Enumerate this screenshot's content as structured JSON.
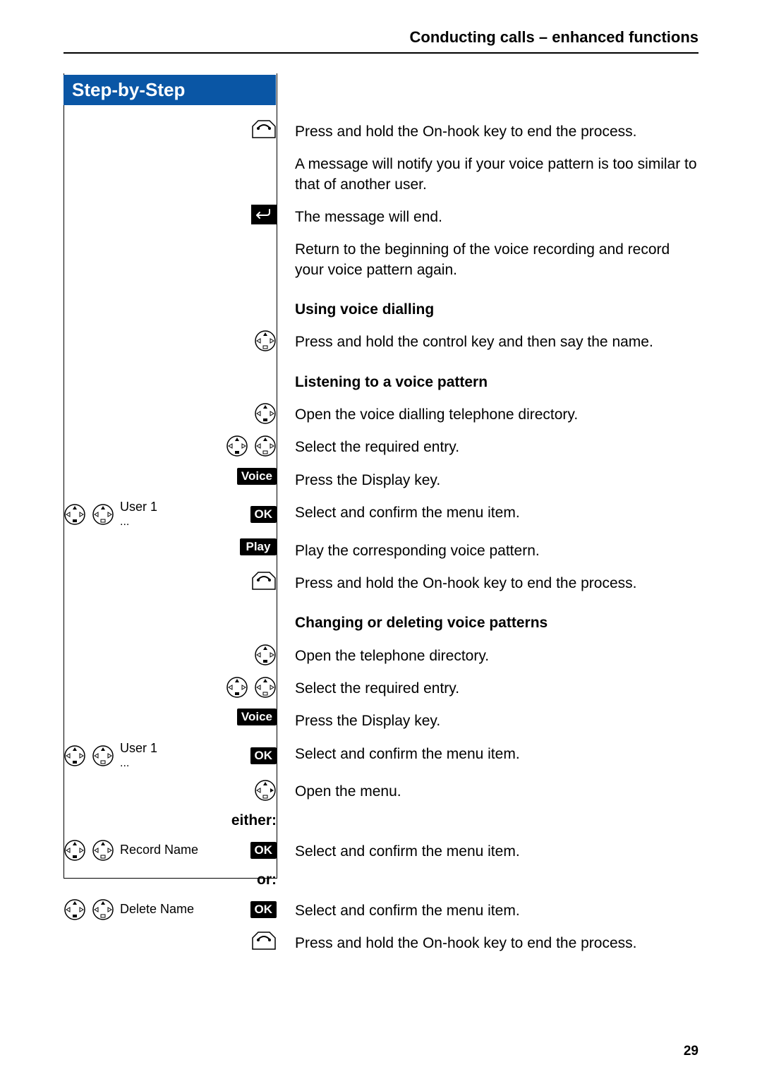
{
  "header": {
    "running_title": "Conducting calls – enhanced functions"
  },
  "banner": {
    "title": "Step-by-Step"
  },
  "labels": {
    "voice_softkey": "Voice",
    "play_softkey": "Play",
    "ok": "OK",
    "either": "either:",
    "or": "or:"
  },
  "menu_items": {
    "user1": "User 1",
    "ellipsis": "...",
    "record_name": "Record Name",
    "delete_name": "Delete Name"
  },
  "steps": {
    "s1": "Press and hold the On-hook key to end the process.",
    "s1b": "A message will notify you if your voice pattern is too similar to that of another user.",
    "s2": "The message will end.",
    "s2b": "Return to the beginning of the voice recording and record your voice pattern again.",
    "h_using": "Using voice dialling",
    "s3": "Press and hold the control key and then say the name.",
    "h_listen": "Listening to a voice pattern",
    "s4": "Open the voice dialling telephone directory.",
    "s5": "Select the required entry.",
    "s6": "Press the Display key.",
    "s7": "Select and confirm the menu item.",
    "s8": "Play the corresponding voice pattern.",
    "s9": "Press and hold the On-hook key to end the process.",
    "h_change": "Changing or deleting voice patterns",
    "s10": "Open the telephone directory.",
    "s11": "Select the required entry.",
    "s12": "Press the Display key.",
    "s13": "Select and confirm the menu item.",
    "s14": "Open the menu.",
    "s15": "Select and confirm the menu item.",
    "s16": "Select and confirm the menu item.",
    "s17": "Press and hold the On-hook key to end the process."
  },
  "page_number": "29"
}
